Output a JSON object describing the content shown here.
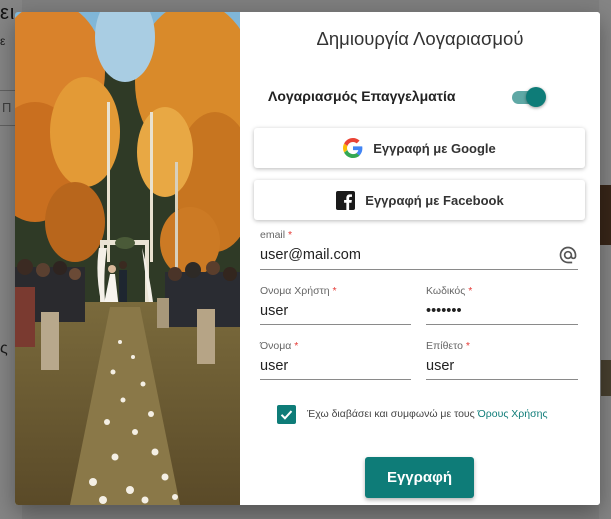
{
  "background": {
    "left_title": "ει",
    "left_subtitle": "ε",
    "left_input_placeholder": "Π",
    "left_symbol": "ς"
  },
  "dialog": {
    "title": "Δημιουργία Λογαριασμού",
    "professional_toggle": {
      "label": "Λογαριασμός Επαγγελματία",
      "on": true
    },
    "google_button": {
      "label": "Εγγραφή με Google",
      "icon": "google-icon"
    },
    "facebook_button": {
      "label": "Εγγραφή με Facebook",
      "icon": "facebook-icon"
    },
    "fields": {
      "email": {
        "label": "email",
        "value": "user@mail.com",
        "icon": "at-icon"
      },
      "username": {
        "label": "Ονομα Χρήστη",
        "value": "user"
      },
      "password": {
        "label": "Κωδικός",
        "value": "•••••••"
      },
      "first_name": {
        "label": "Όνομα",
        "value": "user"
      },
      "last_name": {
        "label": "Επίθετο",
        "value": "user"
      }
    },
    "required_marker": "*",
    "terms": {
      "checked": true,
      "text": "Έχω διαβάσει και συμφωνώ με τους ",
      "link": "Όρους Χρήσης"
    },
    "submit_label": "Εγγραφή"
  },
  "colors": {
    "accent": "#0e7c78",
    "toggle_track": "#5fa8a5",
    "required": "#e53935",
    "overlay": "rgba(0,0,0,0.48)"
  }
}
